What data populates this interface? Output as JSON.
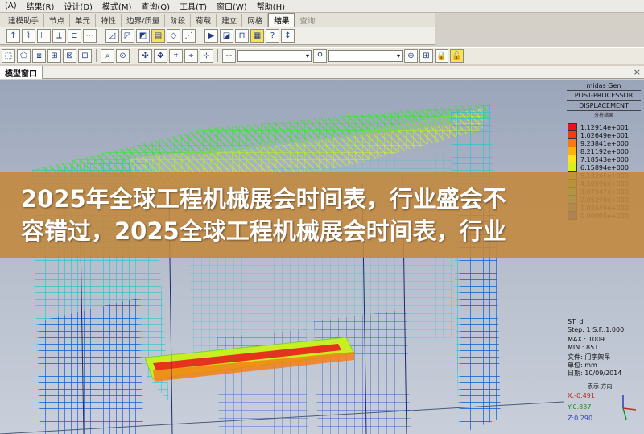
{
  "menu": {
    "items": [
      "(A)",
      "结果(R)",
      "设计(D)",
      "模式(M)",
      "查询(Q)",
      "工具(T)",
      "窗口(W)",
      "帮助(H)"
    ]
  },
  "ribbon_tabs": [
    {
      "label": "建模助手",
      "state": "normal"
    },
    {
      "label": "节点",
      "state": "normal"
    },
    {
      "label": "单元",
      "state": "normal"
    },
    {
      "label": "特性",
      "state": "normal"
    },
    {
      "label": "边界/质量",
      "state": "normal"
    },
    {
      "label": "阶段",
      "state": "normal"
    },
    {
      "label": "荷载",
      "state": "normal"
    },
    {
      "label": "建立",
      "state": "normal"
    },
    {
      "label": "网格",
      "state": "normal"
    },
    {
      "label": "结果",
      "state": "active"
    },
    {
      "label": "查询",
      "state": "disabled"
    }
  ],
  "window": {
    "title": "模型窗口",
    "close_label": "×"
  },
  "legend": {
    "program": "midas Gen",
    "processor": "POST-PROCESSOR",
    "result_type": "DISPLACEMENT",
    "subtitle": "分析结果",
    "entries": [
      {
        "value": "1.12914e+001",
        "color": "#e8141c"
      },
      {
        "value": "1.02649e+001",
        "color": "#f23c14"
      },
      {
        "value": "9.23841e+000",
        "color": "#f87a12"
      },
      {
        "value": "8.21192e+000",
        "color": "#ffb10e"
      },
      {
        "value": "7.18543e+000",
        "color": "#ffe21a"
      },
      {
        "value": "6.15894e+000",
        "color": "#d6f021"
      },
      {
        "value": "5.13245e+000",
        "color": "#9cf22e"
      },
      {
        "value": "4.10596e+000",
        "color": "#4ef23d"
      },
      {
        "value": "3.07947e+000",
        "color": "#1ef07a"
      },
      {
        "value": "2.05298e+000",
        "color": "#17e0c8"
      },
      {
        "value": "1.02649e+000",
        "color": "#179ce8"
      },
      {
        "value": "0.00000e+000",
        "color": "#1c50f0"
      }
    ],
    "st": "ST: dl",
    "step": "Step: 1 S.F.:1.000",
    "max": "MAX : 1009",
    "min": "MIN : 851",
    "file": "文件: 门字架吊",
    "unit": "单位: mm",
    "date": "日期: 10/09/2014",
    "view_dir": "表示-方向",
    "axes": {
      "x": "X:-0.491",
      "y": "Y:0.837",
      "z": "Z:0.290"
    }
  },
  "overlay": {
    "line1": "2025年全球工程机械展会时间表，行业盛会不",
    "line2": "容错过，2025全球工程机械展会时间表，行业"
  }
}
